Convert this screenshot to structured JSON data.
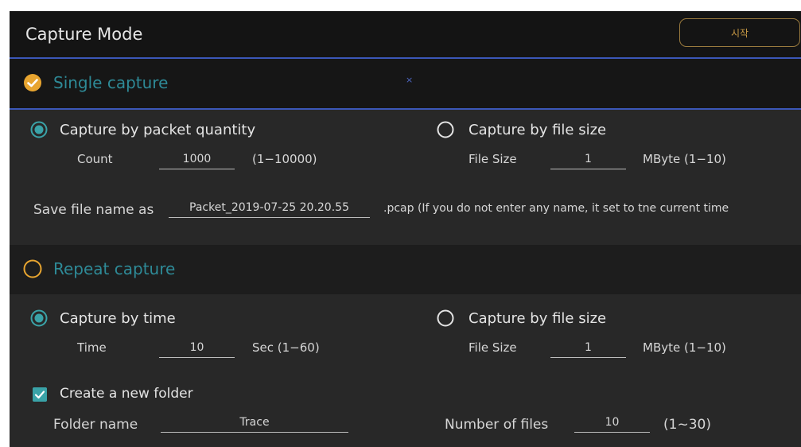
{
  "window": {
    "title": "Capture Mode",
    "start_button": "시작"
  },
  "single": {
    "header": "Single capture",
    "close_glyph": "×",
    "by_quantity": {
      "label": "Capture by packet quantity",
      "field_label": "Count",
      "value": "1000",
      "range": "(1−10000)"
    },
    "by_size": {
      "label": "Capture by file size",
      "field_label": "File Size",
      "value": "1",
      "range": "MByte (1−10)"
    },
    "save_label": "Save file name as",
    "save_value": "Packet_2019-07-25 20.20.55",
    "save_hint": ".pcap  (If you do not enter any name, it set to tne current time"
  },
  "repeat": {
    "header": "Repeat capture",
    "by_time": {
      "label": "Capture by time",
      "field_label": "Time",
      "value": "10",
      "range": "Sec (1−60)"
    },
    "by_size": {
      "label": "Capture by file size",
      "field_label": "File Size",
      "value": "1",
      "range": "MByte (1−10)"
    },
    "new_folder_label": "Create a new folder",
    "folder_label": "Folder name",
    "folder_value": "Trace",
    "files_label": "Number of files",
    "files_value": "10",
    "files_range": "(1~30)"
  },
  "colors": {
    "accent_teal": "#2e8a97",
    "accent_orange": "#e8a530",
    "rule_blue": "#3b57b8"
  }
}
